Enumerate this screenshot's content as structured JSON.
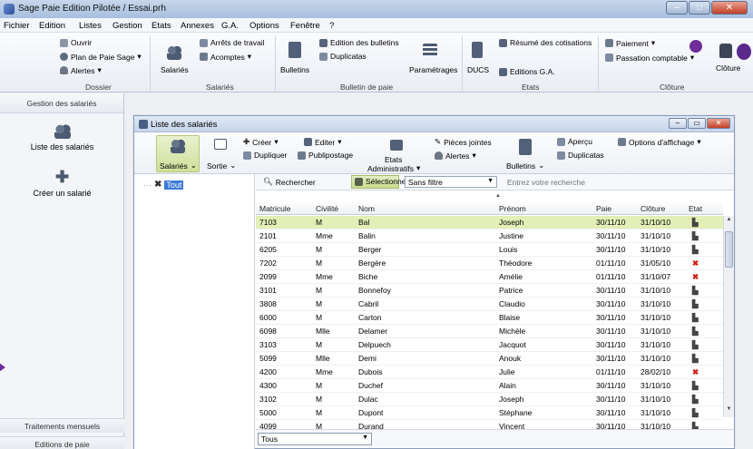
{
  "window": {
    "title": "Sage Paie Edition Pilotée  / Essai.prh"
  },
  "menu": [
    "Fichier",
    "Edition",
    "Listes",
    "Gestion",
    "Etats",
    "Annexes",
    "G.A.",
    "Options",
    "Fenêtre",
    "?"
  ],
  "ribbon": {
    "dossier": {
      "ouvrir": "Ouvrir",
      "plan": "Plan de Paie Sage",
      "alertes": "Alertes",
      "group": "Dossier"
    },
    "salaries": {
      "salaries": "Salariés",
      "arrets": "Arrêts de travail",
      "acomptes": "Acomptes",
      "group": "Salariés"
    },
    "bulletin": {
      "bulletins": "Bulletins",
      "edition": "Edition des bulletins",
      "duplicatas": "Duplicatas",
      "parametrages": "Paramétrages",
      "group": "Bulletin de paie"
    },
    "etats": {
      "ducs": "DUCS",
      "resume": "Résumé des cotisations",
      "editions": "Editions G.A.",
      "group": "Etats"
    },
    "cloture": {
      "paiement": "Paiement",
      "passation": "Passation comptable",
      "cloture": "Clôture",
      "group": "Clôture"
    }
  },
  "leftnav": {
    "header": "Gestion des salariés",
    "liste": "Liste des salariés",
    "creer": "Créer un salarié",
    "traitements": "Traitements mensuels",
    "editions": "Editions de paie"
  },
  "child": {
    "title": "Liste des salariés",
    "toolbar": {
      "salaries": "Salariés",
      "sortie": "Sortie",
      "creer": "Créer",
      "editer": "Editer",
      "dupliquer": "Dupliquer",
      "publipostage": "Publipostage",
      "etats_admin_1": "Etats",
      "etats_admin_2": "Administratifs",
      "pieces": "Pièces jointes",
      "alertes": "Alertes",
      "bulletins": "Bulletins",
      "apercu": "Aperçu",
      "duplicatas": "Duplicatas",
      "options": "Options d'affichage"
    },
    "tree": {
      "root": "Tout"
    },
    "search": {
      "rechercher": "Rechercher",
      "selectionner": "Sélectionner",
      "filter": "Sans filtre",
      "placeholder": "Entrez votre recherche"
    },
    "columns": [
      "Matricule",
      "Civilité",
      "Nom",
      "Prénom",
      "Paie",
      "Clôture",
      "Etat"
    ],
    "rows": [
      {
        "matricule": "7103",
        "civilite": "M",
        "nom": "Bal",
        "prenom": "Joseph",
        "paie": "30/11/10",
        "cloture": "31/10/10",
        "etat": "ok"
      },
      {
        "matricule": "2101",
        "civilite": "Mme",
        "nom": "Balin",
        "prenom": "Justine",
        "paie": "30/11/10",
        "cloture": "31/10/10",
        "etat": "ok"
      },
      {
        "matricule": "6205",
        "civilite": "M",
        "nom": "Berger",
        "prenom": "Louis",
        "paie": "30/11/10",
        "cloture": "31/10/10",
        "etat": "ok"
      },
      {
        "matricule": "7202",
        "civilite": "M",
        "nom": "Bergère",
        "prenom": "Théodore",
        "paie": "01/11/10",
        "cloture": "31/05/10",
        "etat": "ko"
      },
      {
        "matricule": "2099",
        "civilite": "Mme",
        "nom": "Biche",
        "prenom": "Amélie",
        "paie": "01/11/10",
        "cloture": "31/10/07",
        "etat": "ko"
      },
      {
        "matricule": "3101",
        "civilite": "M",
        "nom": "Bonnefoy",
        "prenom": "Patrice",
        "paie": "30/11/10",
        "cloture": "31/10/10",
        "etat": "ok"
      },
      {
        "matricule": "3808",
        "civilite": "M",
        "nom": "Cabril",
        "prenom": "Claudio",
        "paie": "30/11/10",
        "cloture": "31/10/10",
        "etat": "ok"
      },
      {
        "matricule": "6000",
        "civilite": "M",
        "nom": "Carton",
        "prenom": "Blaise",
        "paie": "30/11/10",
        "cloture": "31/10/10",
        "etat": "ok"
      },
      {
        "matricule": "6098",
        "civilite": "Mlle",
        "nom": "Delamer",
        "prenom": "Michèle",
        "paie": "30/11/10",
        "cloture": "31/10/10",
        "etat": "ok"
      },
      {
        "matricule": "3103",
        "civilite": "M",
        "nom": "Delpuech",
        "prenom": "Jacquot",
        "paie": "30/11/10",
        "cloture": "31/10/10",
        "etat": "ok"
      },
      {
        "matricule": "5099",
        "civilite": "Mlle",
        "nom": "Demi",
        "prenom": "Anouk",
        "paie": "30/11/10",
        "cloture": "31/10/10",
        "etat": "ok"
      },
      {
        "matricule": "4200",
        "civilite": "Mme",
        "nom": "Dubois",
        "prenom": "Julie",
        "paie": "01/11/10",
        "cloture": "28/02/10",
        "etat": "ko"
      },
      {
        "matricule": "4300",
        "civilite": "M",
        "nom": "Duchef",
        "prenom": "Alain",
        "paie": "30/11/10",
        "cloture": "31/10/10",
        "etat": "ok"
      },
      {
        "matricule": "3102",
        "civilite": "M",
        "nom": "Dulac",
        "prenom": "Joseph",
        "paie": "30/11/10",
        "cloture": "31/10/10",
        "etat": "ok"
      },
      {
        "matricule": "5000",
        "civilite": "M",
        "nom": "Dupont",
        "prenom": "Stéphane",
        "paie": "30/11/10",
        "cloture": "31/10/10",
        "etat": "ok"
      },
      {
        "matricule": "4099",
        "civilite": "M",
        "nom": "Durand",
        "prenom": "Vincent",
        "paie": "30/11/10",
        "cloture": "31/10/10",
        "etat": "ok"
      }
    ],
    "bottom_filter": "Tous"
  }
}
